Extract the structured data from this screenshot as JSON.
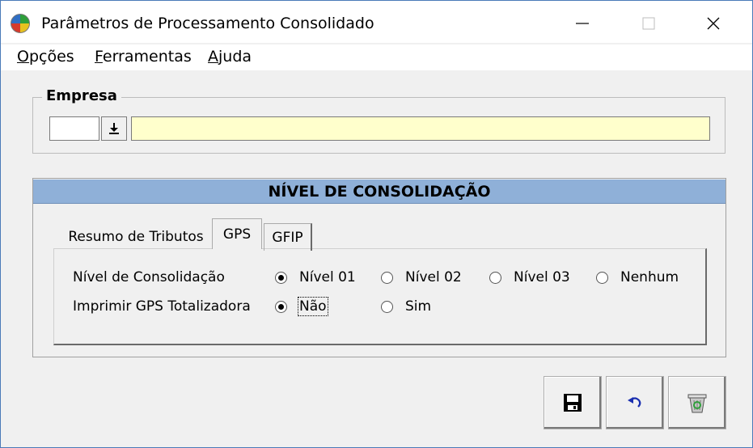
{
  "window": {
    "title": "Parâmetros de Processamento Consolidado",
    "controls": {
      "minimize": "—",
      "maximize": "☐",
      "close": "✕"
    }
  },
  "menu": [
    {
      "mnemonic": "O",
      "rest": "pções"
    },
    {
      "mnemonic": "F",
      "rest": "erramentas"
    },
    {
      "mnemonic": "A",
      "rest": "juda"
    }
  ],
  "empresa": {
    "legend": "Empresa",
    "code_value": "",
    "name_value": "",
    "name_bg": "#ffffcc"
  },
  "consolidacao": {
    "header": "NÍVEL DE CONSOLIDAÇÃO",
    "header_bg": "#8fb0d8",
    "tabs": [
      "Resumo de Tributos",
      "GPS",
      "GFIP"
    ],
    "active_tab": "GPS",
    "nivel": {
      "label": "Nível de Consolidação",
      "options": [
        "Nível 01",
        "Nível 02",
        "Nível 03",
        "Nenhum"
      ],
      "selected": "Nível 01"
    },
    "imprimir": {
      "label": "Imprimir GPS Totalizadora",
      "options": [
        "Não",
        "Sim"
      ],
      "selected": "Não"
    }
  },
  "actions": [
    {
      "name": "save-button",
      "icon": "floppy-disk-icon"
    },
    {
      "name": "undo-button",
      "icon": "undo-arrow-icon"
    },
    {
      "name": "delete-button",
      "icon": "recycle-bin-icon"
    }
  ]
}
